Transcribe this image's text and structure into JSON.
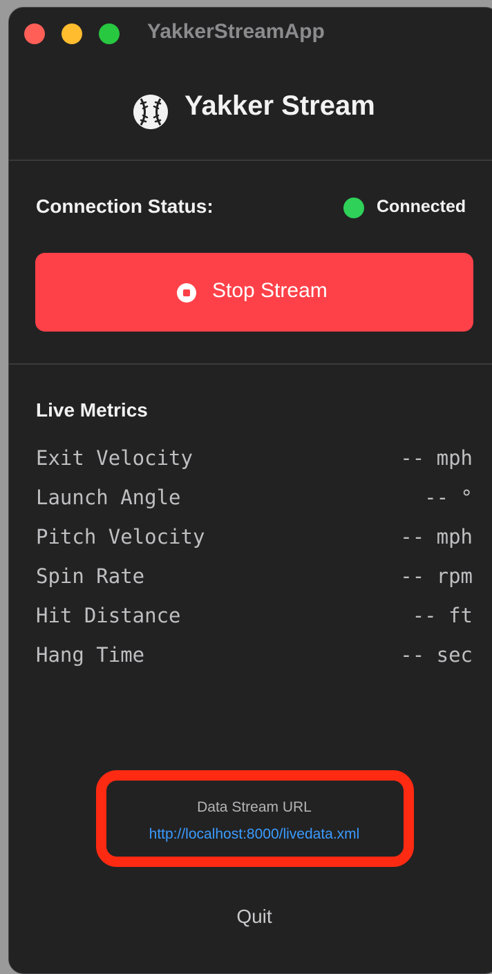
{
  "window": {
    "title": "YakkerStreamApp"
  },
  "header": {
    "app_name": "Yakker Stream",
    "logo_icon": "baseball-icon"
  },
  "connection": {
    "label": "Connection Status:",
    "status": "Connected",
    "status_color": "#2fd158"
  },
  "stream_button": {
    "label": "Stop Stream",
    "icon": "stop-circle-icon",
    "color": "#fe4149"
  },
  "metrics": {
    "title": "Live Metrics",
    "items": [
      {
        "name": "Exit Velocity",
        "value": "-- mph"
      },
      {
        "name": "Launch Angle",
        "value": "-- °"
      },
      {
        "name": "Pitch Velocity",
        "value": "-- mph"
      },
      {
        "name": "Spin Rate",
        "value": "-- rpm"
      },
      {
        "name": "Hit Distance",
        "value": "-- ft"
      },
      {
        "name": "Hang Time",
        "value": "-- sec"
      }
    ]
  },
  "data_stream": {
    "label": "Data Stream URL",
    "url": "http://localhost:8000/livedata.xml",
    "highlight_color": "#ff2a12"
  },
  "footer": {
    "quit_label": "Quit"
  }
}
